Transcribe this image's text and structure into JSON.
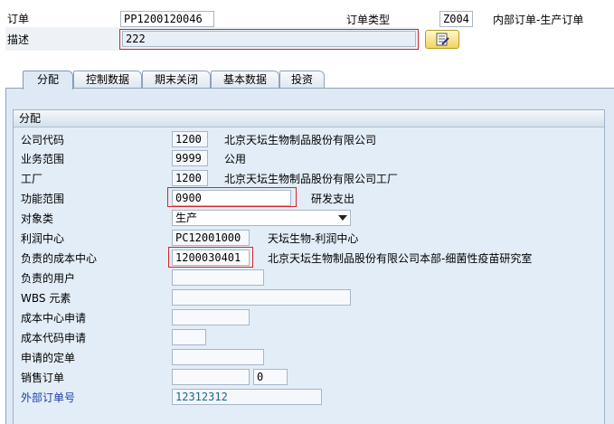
{
  "header": {
    "order_label": "订单",
    "order_value": "PP1200120046",
    "order_type_label": "订单类型",
    "order_type_value": "Z004",
    "order_type_desc": "内部订单-生产订单",
    "desc_label": "描述",
    "desc_value": "222",
    "edit_text_icon": "edit-text-icon"
  },
  "tabs": [
    {
      "label": "分配",
      "active": true
    },
    {
      "label": "控制数据",
      "active": false
    },
    {
      "label": "期末关闭",
      "active": false
    },
    {
      "label": "基本数据",
      "active": false
    },
    {
      "label": "投资",
      "active": false
    }
  ],
  "group": {
    "title": "分配",
    "fields": {
      "company_code": {
        "label": "公司代码",
        "value": "1200",
        "desc": "北京天坛生物制品股份有限公司"
      },
      "business_area": {
        "label": "业务范围",
        "value": "9999",
        "desc": "公用"
      },
      "plant": {
        "label": "工厂",
        "value": "1200",
        "desc": "北京天坛生物制品股份有限公司工厂"
      },
      "functional_area": {
        "label": "功能范围",
        "value": "0900",
        "desc": "研发支出"
      },
      "object_class": {
        "label": "对象类",
        "value": "生产"
      },
      "profit_center": {
        "label": "利润中心",
        "value": "PC12001000",
        "desc": "天坛生物-利润中心"
      },
      "responsible_cost_center": {
        "label": "负责的成本中心",
        "value": "1200030401",
        "desc": "北京天坛生物制品股份有限公司本部-细菌性疫苗研究室"
      },
      "responsible_user": {
        "label": "负责的用户",
        "value": ""
      },
      "wbs_element": {
        "label": "WBS 元素",
        "value": ""
      },
      "cost_center_request": {
        "label": "成本中心申请",
        "value": ""
      },
      "cost_code_request": {
        "label": "成本代码申请",
        "value": ""
      },
      "requesting_order": {
        "label": "申请的定单",
        "value": ""
      },
      "sales_order": {
        "label": "销售订单",
        "value": "",
        "item": "0"
      },
      "external_order": {
        "label": "外部订单号",
        "value": "12312312"
      }
    }
  },
  "colors": {
    "highlight": "#d9242a",
    "link_label": "#1b3fa8",
    "link_value": "#1a6a8a"
  }
}
